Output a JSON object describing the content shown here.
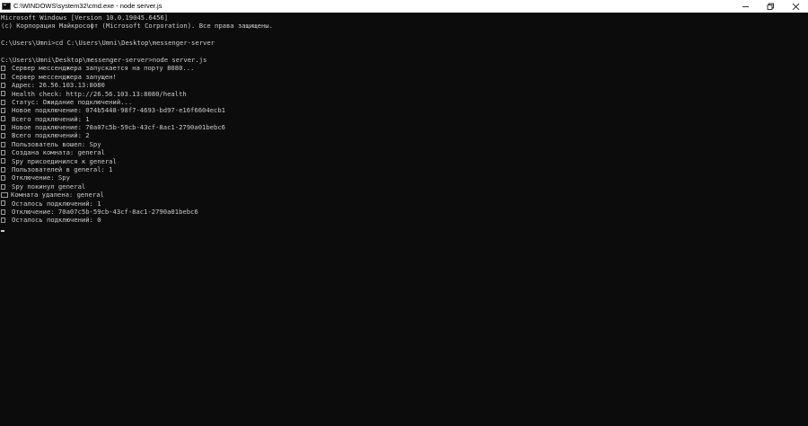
{
  "window": {
    "title": "C:\\WINDOWS\\system32\\cmd.exe - node  server.js",
    "icon": "cmd-icon",
    "controls": [
      "minimize-icon",
      "maximize-icon",
      "close-icon"
    ]
  },
  "console": {
    "lines": [
      {
        "text": "Microsoft Windows [Version 10.0.19045.6456]",
        "glyph": ""
      },
      {
        "text": "(c) Корпорация Майкрософт (Microsoft Corporation). Все права защищены.",
        "glyph": ""
      },
      {
        "text": "",
        "glyph": ""
      },
      {
        "text": "C:\\Users\\Umni>cd C:\\Users\\Umni\\Desktop\\messenger-server",
        "glyph": ""
      },
      {
        "text": "",
        "glyph": ""
      },
      {
        "text": "C:\\Users\\Umni\\Desktop\\messenger-server>node server.js",
        "glyph": ""
      },
      {
        "text": "Сервер мессенджера запускается на порту 8080...",
        "glyph": "box"
      },
      {
        "text": "Сервер мессенджера запущен!",
        "glyph": "box"
      },
      {
        "text": "Адрес: 26.56.103.13:8080",
        "glyph": "box"
      },
      {
        "text": "Health check: http://26.56.103.13:8080/health",
        "glyph": "box"
      },
      {
        "text": "Статус: Ожидание подключений...",
        "glyph": "box"
      },
      {
        "text": "Новое подключение: 074b5448-98f7-4693-bd97-e16f6604ecb1",
        "glyph": "box"
      },
      {
        "text": "Всего подключений: 1",
        "glyph": "box"
      },
      {
        "text": "Новое подключение: 70a07c5b-59cb-43cf-8ac1-2790a01bebc6",
        "glyph": "box"
      },
      {
        "text": "Всего подключений: 2",
        "glyph": "box"
      },
      {
        "text": "Пользователь вошел: Spy",
        "glyph": "box"
      },
      {
        "text": "Создана комната: general",
        "glyph": "box"
      },
      {
        "text": "Spy присоединился к general",
        "glyph": "box"
      },
      {
        "text": "Пользователей в general: 1",
        "glyph": "box"
      },
      {
        "text": "Отключение: Spy",
        "glyph": "box"
      },
      {
        "text": "Spy покинул general",
        "glyph": "box"
      },
      {
        "text": "Комната удалена: general",
        "glyph": "wide"
      },
      {
        "text": "Осталось подключений: 1",
        "glyph": "box"
      },
      {
        "text": "Отключение: 70a07c5b-59cb-43cf-8ac1-2790a01bebc6",
        "glyph": "box"
      },
      {
        "text": "Осталось подключений: 0",
        "glyph": "box"
      }
    ],
    "colors": {
      "background": "#0c0c0c",
      "foreground": "#cccccc"
    }
  }
}
